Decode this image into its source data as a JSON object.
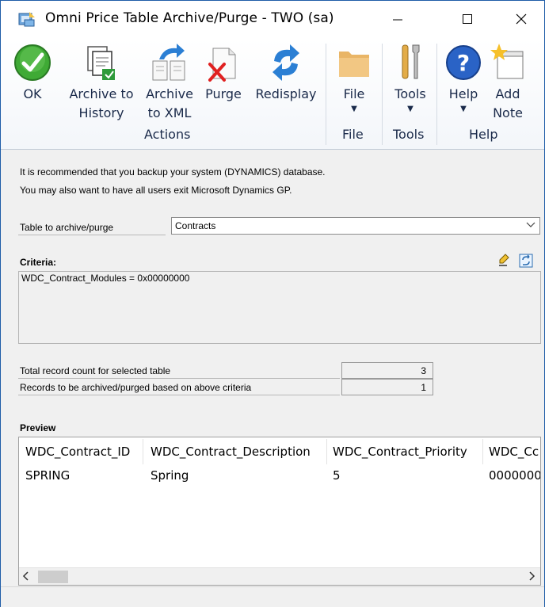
{
  "window": {
    "title": "Omni Price Table Archive/Purge  -  TWO (sa)",
    "icon": "dynamics-gp-app-icon"
  },
  "ribbon": {
    "buttons": [
      {
        "id": "ok",
        "label": "OK",
        "icon": "checkmark-icon"
      },
      {
        "id": "archive_history",
        "label_line1": "Archive to",
        "label_line2": "History",
        "icon": "archive-history-icon"
      },
      {
        "id": "archive_xml",
        "label_line1": "Archive",
        "label_line2": "to XML",
        "icon": "archive-xml-icon"
      },
      {
        "id": "purge",
        "label": "Purge",
        "icon": "purge-icon"
      },
      {
        "id": "redisplay",
        "label": "Redisplay",
        "icon": "refresh-icon"
      },
      {
        "id": "file",
        "label": "File",
        "icon": "folder-icon"
      },
      {
        "id": "tools",
        "label": "Tools",
        "icon": "tools-icon"
      },
      {
        "id": "help",
        "label": "Help",
        "icon": "help-icon"
      },
      {
        "id": "add_note",
        "label_line1": "Add",
        "label_line2": "Note",
        "icon": "note-icon"
      }
    ],
    "groups": {
      "actions": "Actions",
      "file": "File",
      "tools": "Tools",
      "help": "Help"
    }
  },
  "notice": {
    "line1": "It is recommended that you backup your system (DYNAMICS) database.",
    "line2": "You may also want to have all users exit Microsoft Dynamics GP."
  },
  "table_select": {
    "label": "Table to archive/purge",
    "value": "Contracts"
  },
  "criteria": {
    "label": "Criteria:",
    "text": "WDC_Contract_Modules = 0x00000000"
  },
  "counts": [
    {
      "label": "Total record count for selected table",
      "value": "3"
    },
    {
      "label": "Records to be archived/purged based on above criteria",
      "value": "1"
    }
  ],
  "preview": {
    "label": "Preview",
    "columns": [
      "WDC_Contract_ID",
      "WDC_Contract_Description",
      "WDC_Contract_Priority",
      "WDC_Cc"
    ],
    "rows": [
      [
        "SPRING",
        "Spring",
        "5",
        "0000000"
      ]
    ]
  },
  "colors": {
    "accent": "#1f5da8",
    "ok_green": "#3faa35",
    "purge_red": "#e02020",
    "refresh_blue": "#2b7fd4"
  }
}
